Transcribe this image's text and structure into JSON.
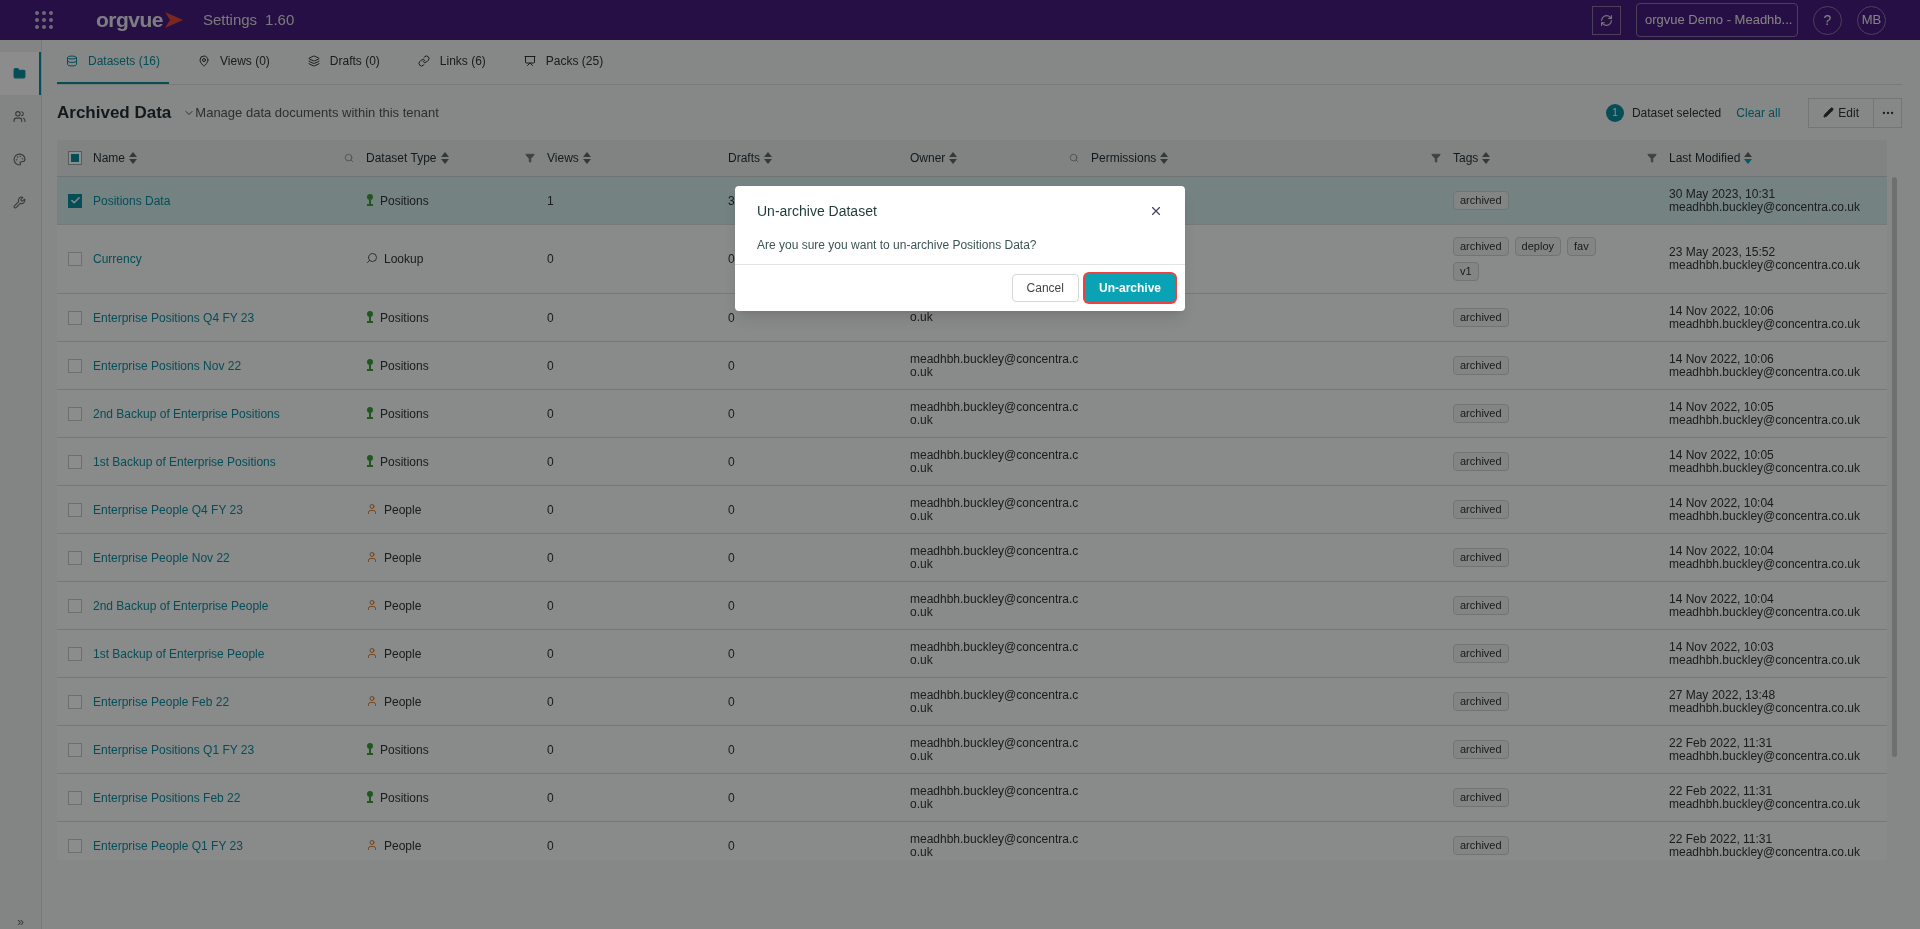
{
  "topbar": {
    "app_name": "orgvue",
    "page_title": "Settings",
    "version": "1.60",
    "tenant": "orgvue Demo - Meadhb...",
    "help": "?",
    "avatar": "MB"
  },
  "sidebar": {
    "items": [
      {
        "selected": true
      },
      {
        "selected": false
      },
      {
        "selected": false
      },
      {
        "selected": false
      }
    ],
    "expand": "»"
  },
  "tabs": [
    {
      "label": "Datasets (16)",
      "selected": true
    },
    {
      "label": "Views (0)",
      "selected": false
    },
    {
      "label": "Drafts (0)",
      "selected": false
    },
    {
      "label": "Links (6)",
      "selected": false
    },
    {
      "label": "Packs (25)",
      "selected": false
    }
  ],
  "heading": {
    "title": "Archived Data",
    "subtitle": "Manage data documents within this tenant"
  },
  "selection": {
    "count": "1",
    "label": "Dataset selected",
    "clear": "Clear all",
    "edit": "Edit"
  },
  "table": {
    "select_all_partial": true,
    "columns": [
      {
        "label": "Name",
        "sorted": false,
        "kind": "search"
      },
      {
        "label": "Dataset Type",
        "sorted": false,
        "kind": "filter"
      },
      {
        "label": "Views",
        "sorted": false
      },
      {
        "label": "Drafts",
        "sorted": false
      },
      {
        "label": "Owner",
        "sorted": false,
        "kind": "search"
      },
      {
        "label": "Permissions",
        "sorted": false,
        "kind": "filter"
      },
      {
        "label": "Tags",
        "sorted": false,
        "kind": "filter"
      },
      {
        "label": "Last Modified",
        "sorted": true
      }
    ],
    "rows": [
      {
        "name": "Positions Data",
        "checked": true,
        "type": {
          "kind": "positions",
          "label": "Positions"
        },
        "views": "1",
        "drafts": "3",
        "tags": [
          "archived"
        ],
        "modified": "30 May 2023, 10:31",
        "modified_by": "meadhbh.buckley@concentra.co.uk"
      },
      {
        "name": "Currency",
        "checked": false,
        "type": {
          "kind": "lookup",
          "label": "Lookup"
        },
        "views": "0",
        "drafts": "0",
        "tags": [
          "archived",
          "deploy",
          "fav",
          "v1"
        ],
        "modified": "23 May 2023, 15:52",
        "modified_by": "meadhbh.buckley@concentra.co.uk"
      },
      {
        "name": "Enterprise Positions Q4 FY 23",
        "checked": false,
        "type": {
          "kind": "positions",
          "label": "Positions"
        },
        "views": "0",
        "drafts": "0",
        "owner": "o.uk",
        "tags": [
          "archived"
        ],
        "modified": "14 Nov 2022, 10:06",
        "modified_by": "meadhbh.buckley@concentra.co.uk"
      },
      {
        "name": "Enterprise Positions Nov 22",
        "checked": false,
        "type": {
          "kind": "positions",
          "label": "Positions"
        },
        "views": "0",
        "drafts": "0",
        "owner": "meadhbh.buckley@concentra.co.uk",
        "tags": [
          "archived"
        ],
        "modified": "14 Nov 2022, 10:06",
        "modified_by": "meadhbh.buckley@concentra.co.uk"
      },
      {
        "name": "2nd Backup of Enterprise Positions",
        "checked": false,
        "type": {
          "kind": "positions",
          "label": "Positions"
        },
        "views": "0",
        "drafts": "0",
        "owner": "meadhbh.buckley@concentra.co.uk",
        "tags": [
          "archived"
        ],
        "modified": "14 Nov 2022, 10:05",
        "modified_by": "meadhbh.buckley@concentra.co.uk"
      },
      {
        "name": "1st Backup of Enterprise Positions",
        "checked": false,
        "type": {
          "kind": "positions",
          "label": "Positions"
        },
        "views": "0",
        "drafts": "0",
        "owner": "meadhbh.buckley@concentra.co.uk",
        "tags": [
          "archived"
        ],
        "modified": "14 Nov 2022, 10:05",
        "modified_by": "meadhbh.buckley@concentra.co.uk"
      },
      {
        "name": "Enterprise People Q4 FY 23",
        "checked": false,
        "type": {
          "kind": "people",
          "label": "People"
        },
        "views": "0",
        "drafts": "0",
        "owner": "meadhbh.buckley@concentra.co.uk",
        "tags": [
          "archived"
        ],
        "modified": "14 Nov 2022, 10:04",
        "modified_by": "meadhbh.buckley@concentra.co.uk"
      },
      {
        "name": "Enterprise People Nov 22",
        "checked": false,
        "type": {
          "kind": "people",
          "label": "People"
        },
        "views": "0",
        "drafts": "0",
        "owner": "meadhbh.buckley@concentra.co.uk",
        "tags": [
          "archived"
        ],
        "modified": "14 Nov 2022, 10:04",
        "modified_by": "meadhbh.buckley@concentra.co.uk"
      },
      {
        "name": "2nd Backup of Enterprise People",
        "checked": false,
        "type": {
          "kind": "people",
          "label": "People"
        },
        "views": "0",
        "drafts": "0",
        "owner": "meadhbh.buckley@concentra.co.uk",
        "tags": [
          "archived"
        ],
        "modified": "14 Nov 2022, 10:04",
        "modified_by": "meadhbh.buckley@concentra.co.uk"
      },
      {
        "name": "1st Backup of Enterprise People",
        "checked": false,
        "type": {
          "kind": "people",
          "label": "People"
        },
        "views": "0",
        "drafts": "0",
        "owner": "meadhbh.buckley@concentra.co.uk",
        "tags": [
          "archived"
        ],
        "modified": "14 Nov 2022, 10:03",
        "modified_by": "meadhbh.buckley@concentra.co.uk"
      },
      {
        "name": "Enterprise People Feb 22",
        "checked": false,
        "type": {
          "kind": "people",
          "label": "People"
        },
        "views": "0",
        "drafts": "0",
        "owner": "meadhbh.buckley@concentra.co.uk",
        "tags": [
          "archived"
        ],
        "modified": "27 May 2022, 13:48",
        "modified_by": "meadhbh.buckley@concentra.co.uk"
      },
      {
        "name": "Enterprise Positions Q1 FY 23",
        "checked": false,
        "type": {
          "kind": "positions",
          "label": "Positions"
        },
        "views": "0",
        "drafts": "0",
        "owner": "meadhbh.buckley@concentra.co.uk",
        "tags": [
          "archived"
        ],
        "modified": "22 Feb 2022, 11:31",
        "modified_by": "meadhbh.buckley@concentra.co.uk"
      },
      {
        "name": "Enterprise Positions Feb 22",
        "checked": false,
        "type": {
          "kind": "positions",
          "label": "Positions"
        },
        "views": "0",
        "drafts": "0",
        "owner": "meadhbh.buckley@concentra.co.uk",
        "tags": [
          "archived"
        ],
        "modified": "22 Feb 2022, 11:31",
        "modified_by": "meadhbh.buckley@concentra.co.uk"
      },
      {
        "name": "Enterprise People Q1 FY 23",
        "checked": false,
        "type": {
          "kind": "people",
          "label": "People"
        },
        "views": "0",
        "drafts": "0",
        "owner": "meadhbh.buckley@concentra.co.uk",
        "tags": [
          "archived"
        ],
        "modified": "22 Feb 2022, 11:31",
        "modified_by": "meadhbh.buckley@concentra.co.uk"
      }
    ]
  },
  "dialog": {
    "title": "Un-archive Dataset",
    "message": "Are you sure you want to un-archive Positions Data?",
    "cancel": "Cancel",
    "confirm": "Un-archive",
    "confirm_highlighted": true
  }
}
